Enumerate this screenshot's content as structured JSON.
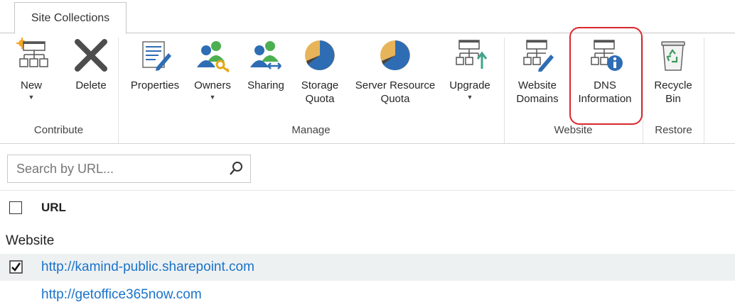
{
  "tabs": [
    {
      "label": "Site Collections"
    }
  ],
  "ribbon": {
    "groups": {
      "contribute": "Contribute",
      "manage": "Manage",
      "website": "Website",
      "restore": "Restore"
    },
    "buttons": {
      "new": {
        "label": "New",
        "icon": "new-site-icon"
      },
      "delete": {
        "label": "Delete",
        "icon": "delete-x-icon"
      },
      "properties": {
        "label": "Properties",
        "icon": "properties-icon"
      },
      "owners": {
        "label": "Owners",
        "icon": "owners-key-icon"
      },
      "sharing": {
        "label": "Sharing",
        "icon": "sharing-icon"
      },
      "storage_quota": {
        "line1": "Storage",
        "line2": "Quota",
        "icon": "pie-chart-icon"
      },
      "server_resource_quota": {
        "line1": "Server Resource",
        "line2": "Quota",
        "icon": "pie-chart-icon"
      },
      "upgrade": {
        "label": "Upgrade",
        "icon": "upgrade-icon"
      },
      "website_domains": {
        "line1": "Website",
        "line2": "Domains",
        "icon": "website-domains-icon"
      },
      "dns_information": {
        "line1": "DNS",
        "line2": "Information",
        "icon": "dns-info-icon"
      },
      "recycle_bin": {
        "line1": "Recycle",
        "line2": "Bin",
        "icon": "recycle-bin-icon"
      }
    }
  },
  "search": {
    "placeholder": "Search by URL...",
    "value": ""
  },
  "table": {
    "column_header": "URL",
    "group_title": "Website",
    "rows": [
      {
        "url": "http://kamind-public.sharepoint.com",
        "checked": true
      },
      {
        "url": "http://getoffice365now.com",
        "checked": false
      }
    ]
  },
  "colors": {
    "link": "#1a73c9",
    "accent": "#2e6db4",
    "highlight": "#d9272e",
    "selected_row": "#eef1f2"
  }
}
